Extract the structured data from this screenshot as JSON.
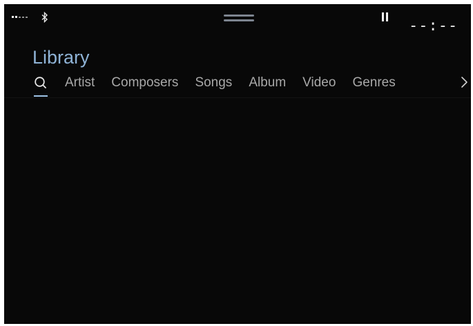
{
  "status_bar": {
    "signal_icon": "signal-strength-icon",
    "bluetooth_icon": "bluetooth-icon",
    "handle_icon": "drag-handle-icon",
    "playback_icon": "pause-icon",
    "clock": "--:--"
  },
  "header": {
    "title": "Library"
  },
  "tabs": {
    "search_icon": "search-icon",
    "items": [
      {
        "label": "Artist"
      },
      {
        "label": "Composers"
      },
      {
        "label": "Songs"
      },
      {
        "label": "Album"
      },
      {
        "label": "Video"
      },
      {
        "label": "Genres"
      }
    ],
    "more_icon": "chevron-right-icon"
  },
  "colors": {
    "background": "#050505",
    "accent": "#8fb3d6",
    "tab_text": "#a8a8a8",
    "status_text": "#ededed"
  }
}
